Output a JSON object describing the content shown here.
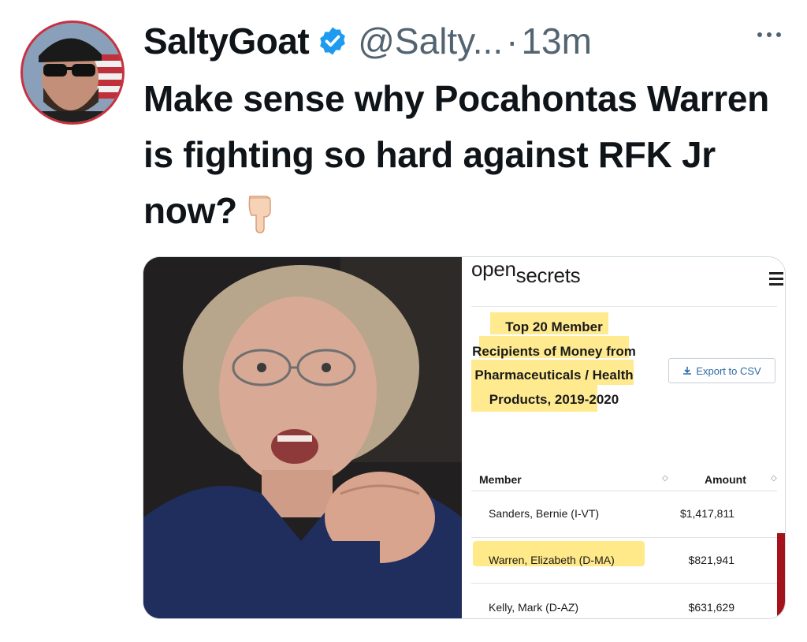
{
  "tweet": {
    "display_name": "SaltyGoat",
    "handle": "@Salty...",
    "separator": "·",
    "time": "13m",
    "text": "Make sense why Pocahontas Warren is fighting so hard against RFK Jr now?",
    "emoji_icon": "pointing-down-hand-icon"
  },
  "opensecrets": {
    "logo_open": "open",
    "logo_secrets": "secrets",
    "title": "Top 20 Member Recipients of Money from Pharmaceuticals / Health Products, 2019-2020",
    "export_label": "Export to CSV",
    "columns": [
      "Member",
      "Amount"
    ],
    "rows": [
      {
        "member": "Sanders, Bernie (I-VT)",
        "amount": "$1,417,811"
      },
      {
        "member": "Warren, Elizabeth (D-MA)",
        "amount": "$821,941"
      },
      {
        "member": "Kelly, Mark (D-AZ)",
        "amount": "$631,629"
      }
    ]
  },
  "colors": {
    "verified_blue": "#1d9bf0",
    "highlight_yellow": "#ffe36a",
    "secondary_text": "#536471",
    "bar_red": "#a4121c"
  }
}
